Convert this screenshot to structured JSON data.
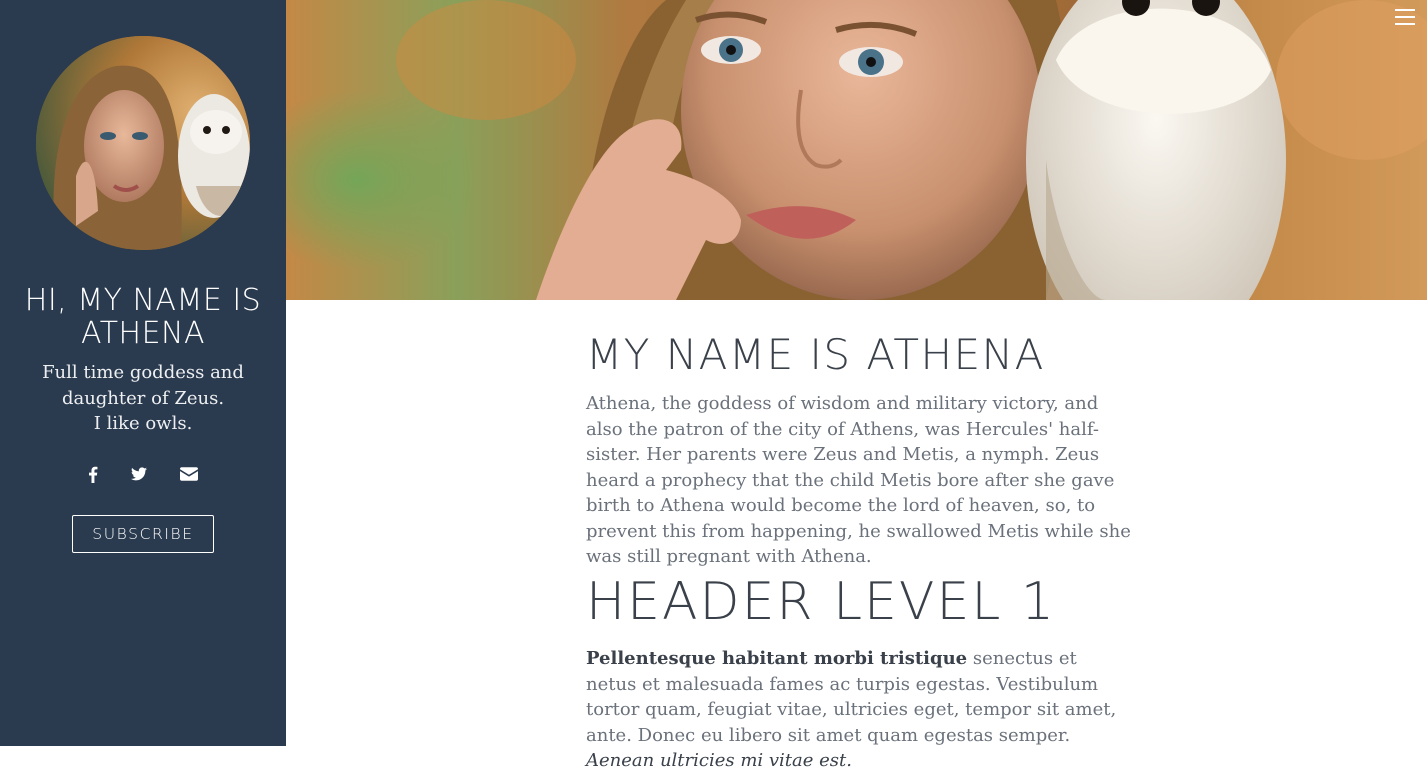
{
  "sidebar": {
    "title": "HI, MY NAME IS ATHENA",
    "tagline_line1": "Full time goddess and",
    "tagline_line2": "daughter of Zeus.",
    "tagline_line3": "I like owls.",
    "social": [
      {
        "icon": "facebook-icon"
      },
      {
        "icon": "twitter-icon"
      },
      {
        "icon": "mail-icon"
      }
    ],
    "subscribe_label": "SUBSCRIBE"
  },
  "header": {
    "menu_icon": "hamburger-menu-icon"
  },
  "main": {
    "section_title": "MY NAME IS ATHENA",
    "intro": "Athena, the goddess of wisdom and military victory, and also the patron of the city of Athens, was Hercules' half-sister. Her parents were Zeus and Metis, a nymph. Zeus heard a prophecy that the child Metis bore after she gave birth to Athena would become the lord of heaven, so, to prevent this from happening, he swallowed Metis while she was still pregnant with Athena.",
    "header1": "HEADER LEVEL 1",
    "body_bold": "Pellentesque habitant morbi tristique",
    "body_text": " senectus et netus et malesuada fames ac turpis egestas. Vestibulum tortor quam, feugiat vitae, ultricies eget, tempor sit amet, ante. Donec eu libero sit amet quam egestas semper. ",
    "body_italic": "Aenean ultricies mi vitae est."
  },
  "colors": {
    "sidebar_bg": "#2a3a4f",
    "heading": "#3a414a",
    "body_text": "#6a717b"
  }
}
